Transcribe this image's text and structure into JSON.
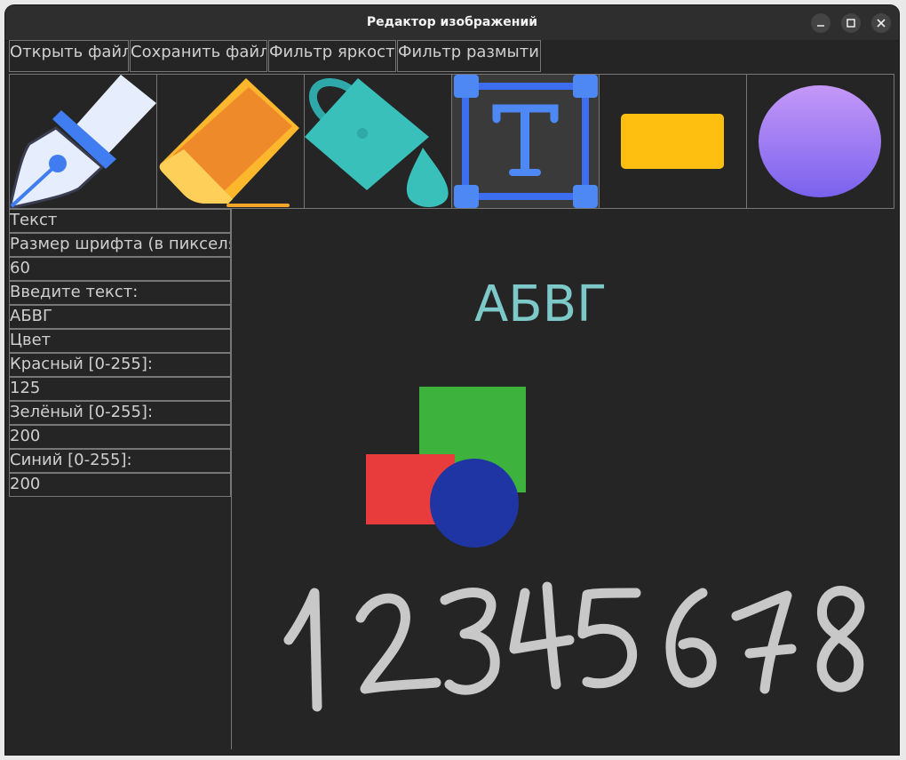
{
  "window": {
    "title": "Редактор изображений"
  },
  "menu": {
    "open_label": "Открыть файл",
    "save_label": "Сохранить файл",
    "brightness_label": "Фильтр яркости",
    "blur_label": "Фильтр размытия"
  },
  "tools": [
    {
      "name": "pen-tool",
      "icon": "fountain-pen-icon"
    },
    {
      "name": "eraser-tool",
      "icon": "eraser-icon"
    },
    {
      "name": "fill-tool",
      "icon": "paint-bucket-icon"
    },
    {
      "name": "text-tool",
      "icon": "text-box-icon"
    },
    {
      "name": "rectangle-tool",
      "icon": "rectangle-icon"
    },
    {
      "name": "ellipse-tool",
      "icon": "ellipse-icon"
    }
  ],
  "panel": {
    "section_text": "Текст",
    "font_size_label": "Размер шрифта (в пикселя",
    "font_size_value": "60",
    "text_label": "Введите текст:",
    "text_value": "АБВГ",
    "section_color": "Цвет",
    "red_label": "Красный [0-255]:",
    "red_value": "125",
    "green_label": "Зелёный [0-255]:",
    "green_value": "200",
    "blue_label": "Синий [0-255]:",
    "blue_value": "200"
  },
  "canvas": {
    "text": "АБВГ",
    "text_color": "#7dc8c8",
    "handwriting": "12345678",
    "handwriting_color": "#c8c8c8",
    "shapes_colors": {
      "green": "#3db33d",
      "red": "#e83c3c",
      "blue": "#1f35a3"
    }
  }
}
